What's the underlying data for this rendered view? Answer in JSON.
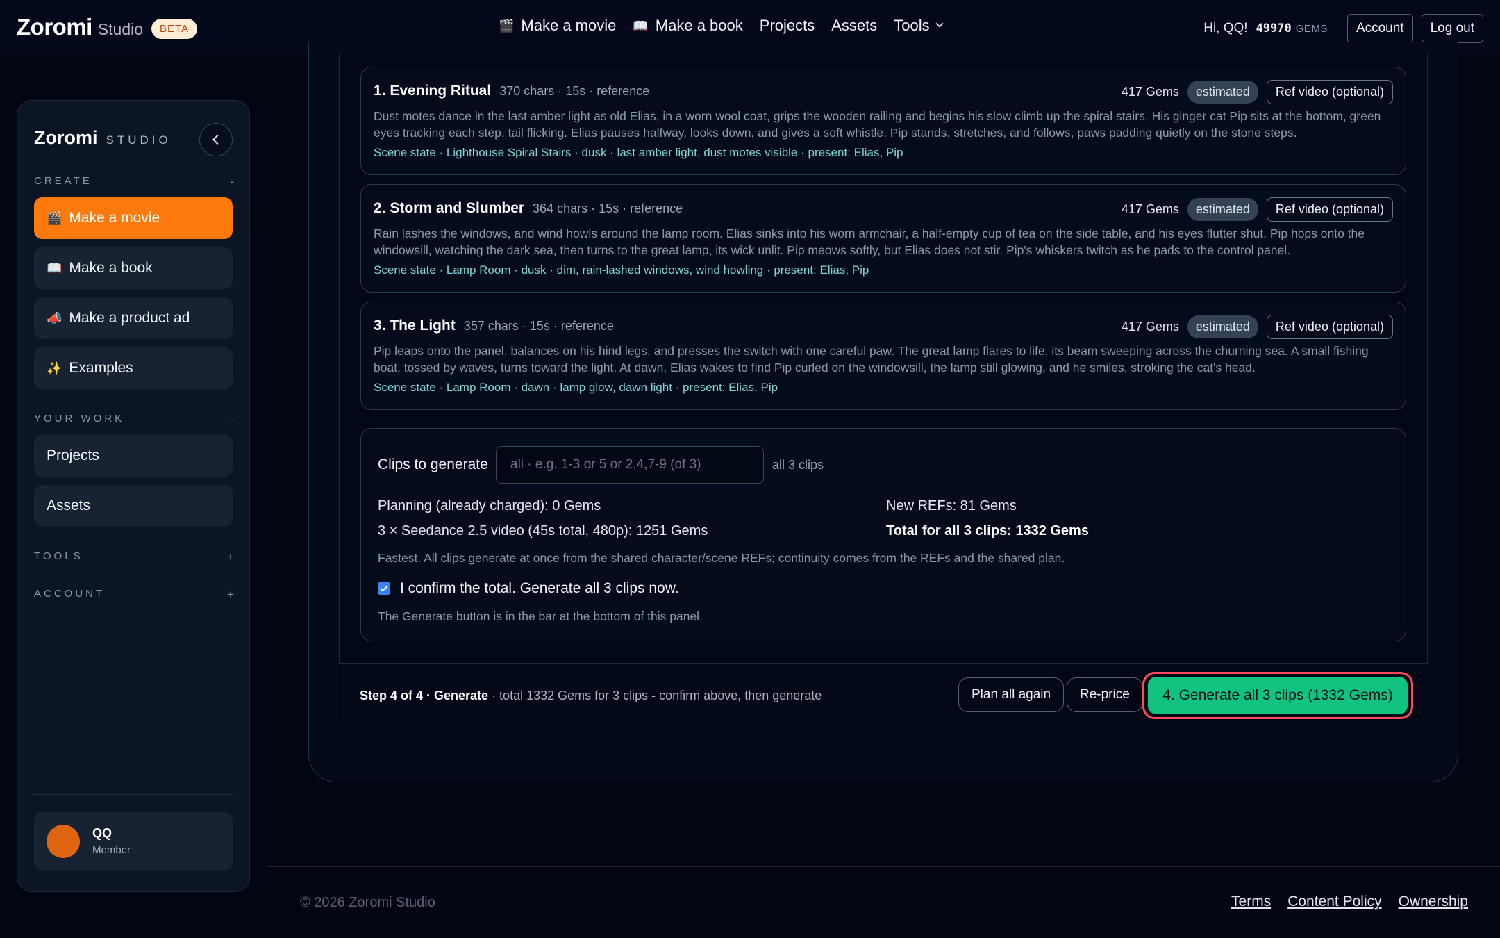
{
  "topbar": {
    "brand": "Zoromi",
    "brand_sub": "Studio",
    "beta": "BETA",
    "nav": [
      {
        "label": "Make a movie",
        "icon": "🎬"
      },
      {
        "label": "Make a book",
        "icon": "📖"
      },
      {
        "label": "Projects"
      },
      {
        "label": "Assets"
      },
      {
        "label": "Tools"
      }
    ],
    "greeting": "Hi, QQ!",
    "gems": "49970",
    "gems_label": "GEMS",
    "account": "Account",
    "logout": "Log out"
  },
  "sidebar": {
    "brand": "Zoromi",
    "brand_sub": "STUDIO",
    "sections": {
      "create": {
        "title": "CREATE",
        "toggle": "-"
      },
      "work": {
        "title": "YOUR WORK",
        "toggle": "-"
      },
      "tools": {
        "title": "TOOLS",
        "toggle": "+"
      },
      "account": {
        "title": "ACCOUNT",
        "toggle": "+"
      }
    },
    "create_items": [
      {
        "label": "Make a movie",
        "icon": "🎬"
      },
      {
        "label": "Make a book",
        "icon": "📖"
      },
      {
        "label": "Make a product ad",
        "icon": "📣"
      },
      {
        "label": "Examples",
        "icon": "✨"
      }
    ],
    "work_items": [
      {
        "label": "Projects"
      },
      {
        "label": "Assets"
      }
    ],
    "user": {
      "name": "QQ",
      "role": "Member"
    }
  },
  "clips": [
    {
      "title": "1. Evening Ritual",
      "meta": "370 chars · 15s · reference",
      "gems": "417 Gems",
      "badge": "estimated",
      "ref_button": "Ref video (optional)",
      "description": "Dust motes dance in the last amber light as old Elias, in a worn wool coat, grips the wooden railing and begins his slow climb up the spiral stairs. His ginger cat Pip sits at the bottom, green eyes tracking each step, tail flicking. Elias pauses halfway, looks down, and gives a soft whistle. Pip stands, stretches, and follows, paws padding quietly on the stone steps.",
      "scene": "Scene state · Lighthouse Spiral Stairs · dusk · last amber light, dust motes visible · present: Elias, Pip"
    },
    {
      "title": "2. Storm and Slumber",
      "meta": "364 chars · 15s · reference",
      "gems": "417 Gems",
      "badge": "estimated",
      "ref_button": "Ref video (optional)",
      "description": "Rain lashes the windows, and wind howls around the lamp room. Elias sinks into his worn armchair, a half-empty cup of tea on the side table, and his eyes flutter shut. Pip hops onto the windowsill, watching the dark sea, then turns to the great lamp, its wick unlit. Pip meows softly, but Elias does not stir. Pip's whiskers twitch as he pads to the control panel.",
      "scene": "Scene state · Lamp Room · dusk · dim, rain-lashed windows, wind howling · present: Elias, Pip"
    },
    {
      "title": "3. The Light",
      "meta": "357 chars · 15s · reference",
      "gems": "417 Gems",
      "badge": "estimated",
      "ref_button": "Ref video (optional)",
      "description": "Pip leaps onto the panel, balances on his hind legs, and presses the switch with one careful paw. The great lamp flares to life, its beam sweeping across the churning sea. A small fishing boat, tossed by waves, turns toward the light. At dawn, Elias wakes to find Pip curled on the windowsill, the lamp still glowing, and he smiles, stroking the cat's head.",
      "scene": "Scene state · Lamp Room · dawn · lamp glow, dawn light · present: Elias, Pip"
    }
  ],
  "generate": {
    "clips_label": "Clips to generate",
    "clips_placeholder": "all · e.g. 1-3 or 5 or 2,4,7-9 (of 3)",
    "clips_hint": "all 3 clips",
    "planning": "Planning (already charged): 0 Gems",
    "video": "3 × Seedance 2.5 video (45s total, 480p): 1251 Gems",
    "new_refs": "New REFs: 81 Gems",
    "total": "Total for all 3 clips: 1332 Gems",
    "note": "Fastest. All clips generate at once from the shared character/scene REFs; continuity comes from the REFs and the shared plan.",
    "confirm": "I confirm the total. Generate all 3 clips now.",
    "confirmed": true,
    "note2": "The Generate button is in the bar at the bottom of this panel."
  },
  "step_bar": {
    "step": "Step 4 of 4 · Generate",
    "summary": " · total 1332 Gems for 3 clips - confirm above, then generate",
    "plan_again": "Plan all again",
    "reprice": "Re-price",
    "generate": "4. Generate all 3 clips (1332 Gems)"
  },
  "footer": {
    "copyright": "© 2026 Zoromi Studio",
    "links": [
      "Terms",
      "Content Policy",
      "Ownership"
    ]
  },
  "colors": {
    "accent_orange": "#ff7a0d",
    "generate_green": "#10c47f",
    "highlight_ring": "#ff4a5e",
    "scene_teal": "#7fd4d6"
  }
}
